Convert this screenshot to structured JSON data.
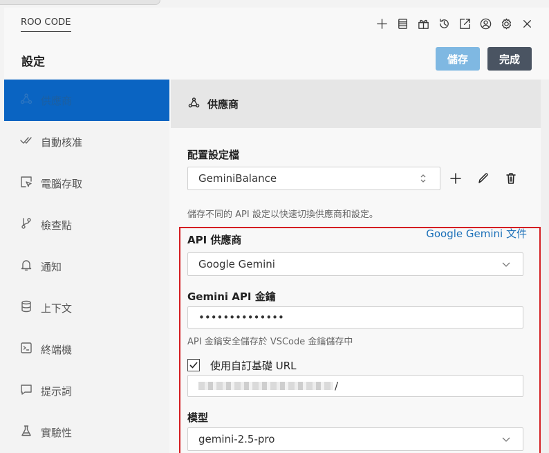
{
  "app": {
    "title": "ROO CODE"
  },
  "title_actions": [
    {
      "name": "plus-icon"
    },
    {
      "name": "database-icon"
    },
    {
      "name": "extensions-icon"
    },
    {
      "name": "history-icon"
    },
    {
      "name": "popout-icon"
    },
    {
      "name": "account-icon"
    },
    {
      "name": "gear-icon"
    },
    {
      "name": "close-icon"
    }
  ],
  "settings": {
    "title": "設定",
    "save_label": "儲存",
    "done_label": "完成"
  },
  "sidebar": {
    "items": [
      {
        "label": "供應商",
        "icon": "webhook-icon",
        "active": true
      },
      {
        "label": "自動核准",
        "icon": "check-all-icon"
      },
      {
        "label": "電腦存取",
        "icon": "cursor-window-icon"
      },
      {
        "label": "檢查點",
        "icon": "git-branch-icon"
      },
      {
        "label": "通知",
        "icon": "bell-icon"
      },
      {
        "label": "上下文",
        "icon": "database-icon"
      },
      {
        "label": "終端機",
        "icon": "terminal-icon"
      },
      {
        "label": "提示詞",
        "icon": "message-icon"
      },
      {
        "label": "實驗性",
        "icon": "flask-icon"
      }
    ]
  },
  "section": {
    "title": "供應商"
  },
  "profile": {
    "label": "配置設定檔",
    "value": "GeminiBalance",
    "help": "儲存不同的 API 設定以快速切換供應商和設定。"
  },
  "provider": {
    "label": "API 供應商",
    "docs_link": "Google Gemini 文件",
    "value": "Google Gemini"
  },
  "api_key": {
    "label": "Gemini API 金鑰",
    "value": "••••••••••••••",
    "help": "API 金鑰安全儲存於 VSCode 金鑰儲存中"
  },
  "custom_url": {
    "label": "使用自訂基礎 URL",
    "checked": true,
    "value_suffix": "/"
  },
  "model": {
    "label": "模型",
    "value": "gemini-2.5-pro"
  },
  "colors": {
    "accent": "#0a64c2",
    "highlight_border": "#d41e22",
    "save_button": "#7fb8e2",
    "done_button": "#4a5462"
  }
}
